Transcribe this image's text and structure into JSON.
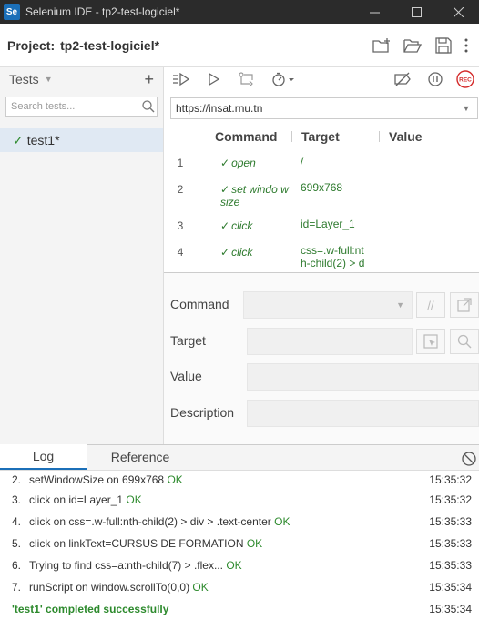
{
  "window": {
    "logo": "Se",
    "title": "Selenium IDE - tp2-test-logiciel*",
    "icons": [
      "minimize-icon",
      "maximize-icon",
      "close-icon"
    ]
  },
  "project": {
    "label": "Project:",
    "name": "tp2-test-logiciel*",
    "icons": [
      "new-folder-icon",
      "open-folder-icon",
      "save-icon",
      "more-vertical-icon"
    ]
  },
  "tests_panel": {
    "title": "Tests",
    "add_label": "+",
    "search_placeholder": "Search tests...",
    "items": [
      {
        "check": "✓",
        "name": "test1*"
      }
    ]
  },
  "toolbar": {
    "icons": [
      "run-all-icon",
      "run-icon",
      "step-icon",
      "speed-icon",
      "disable-breakpoints-icon",
      "pause-icon",
      "record-icon"
    ],
    "record_label": "REC"
  },
  "url": {
    "value": "https://insat.rnu.tn"
  },
  "command_table": {
    "headers": {
      "command": "Command",
      "target": "Target",
      "value": "Value"
    },
    "rows": [
      {
        "index": "1",
        "command": "open",
        "target": "/",
        "value": ""
      },
      {
        "index": "2",
        "command": "set windo w size",
        "target": "699x768",
        "value": ""
      },
      {
        "index": "3",
        "command": "click",
        "target": "id=Layer_1",
        "value": ""
      },
      {
        "index": "4",
        "command": "click",
        "target": "css=.w-full:nt h-child(2) > d",
        "value": ""
      }
    ]
  },
  "editor": {
    "command_label": "Command",
    "target_label": "Target",
    "value_label": "Value",
    "description_label": "Description",
    "comment_button": "//"
  },
  "log_panel": {
    "tabs": [
      "Log",
      "Reference"
    ],
    "active_tab": "Log",
    "entries": [
      {
        "num": "2.",
        "text": "setWindowSize on 699x768",
        "status": "OK",
        "time": "15:35:32"
      },
      {
        "num": "3.",
        "text": "click on id=Layer_1",
        "status": "OK",
        "time": "15:35:32"
      },
      {
        "num": "4.",
        "text": "click on css=.w-full:nth-child(2) > div > .text-center",
        "status": "OK",
        "time": "15:35:33"
      },
      {
        "num": "5.",
        "text": "click on linkText=CURSUS DE FORMATION",
        "status": "OK",
        "time": "15:35:33"
      },
      {
        "num": "6.",
        "text": "Trying to find css=a:nth-child(7) > .flex...",
        "status": "OK",
        "time": "15:35:33"
      },
      {
        "num": "7.",
        "text": "runScript on window.scrollTo(0,0)",
        "status": "OK",
        "time": "15:35:34"
      }
    ],
    "completion": {
      "text": "'test1' completed successfully",
      "time": "15:35:34"
    }
  },
  "colors": {
    "accent": "#1b6fb8",
    "success": "#2d8a2d",
    "record": "#d42b2b",
    "titlebar": "#2b2b2b"
  }
}
